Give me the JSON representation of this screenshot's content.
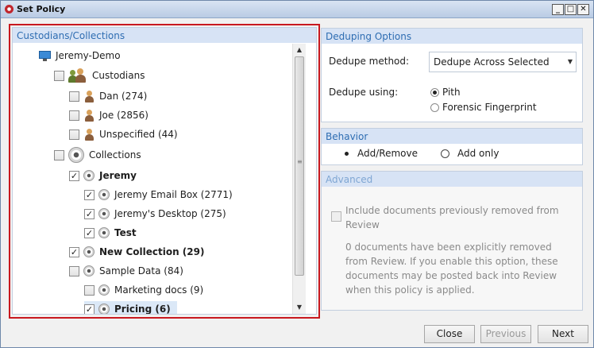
{
  "window": {
    "title": "Set Policy",
    "min": "_",
    "max": "□",
    "close": "✕"
  },
  "left": {
    "header": "Custodians/Collections",
    "tree": [
      {
        "label": "Jeremy-Demo",
        "icon": "monitor",
        "checkbox": false,
        "checked": false,
        "bold": false
      },
      {
        "label": "Custodians",
        "icon": "people",
        "checkbox": true,
        "checked": false,
        "bold": false
      },
      {
        "label": "Dan (274)",
        "icon": "person",
        "checkbox": true,
        "checked": false,
        "bold": false
      },
      {
        "label": "Joe (2856)",
        "icon": "person",
        "checkbox": true,
        "checked": false,
        "bold": false
      },
      {
        "label": "Unspecified (44)",
        "icon": "person",
        "checkbox": true,
        "checked": false,
        "bold": false
      },
      {
        "label": "Collections",
        "icon": "disc-big",
        "checkbox": true,
        "checked": false,
        "bold": false
      },
      {
        "label": "Jeremy",
        "icon": "disc",
        "checkbox": true,
        "checked": true,
        "bold": true
      },
      {
        "label": "Jeremy Email Box (2771)",
        "icon": "disc",
        "checkbox": true,
        "checked": true,
        "bold": false
      },
      {
        "label": "Jeremy's Desktop (275)",
        "icon": "disc",
        "checkbox": true,
        "checked": true,
        "bold": false
      },
      {
        "label": "Test",
        "icon": "disc",
        "checkbox": true,
        "checked": true,
        "bold": true
      },
      {
        "label": "New Collection (29)",
        "icon": "disc",
        "checkbox": true,
        "checked": true,
        "bold": true
      },
      {
        "label": "Sample Data (84)",
        "icon": "disc",
        "checkbox": true,
        "checked": false,
        "bold": false
      },
      {
        "label": "Marketing docs (9)",
        "icon": "disc",
        "checkbox": true,
        "checked": false,
        "bold": false
      },
      {
        "label": "Pricing (6)",
        "icon": "disc",
        "checkbox": true,
        "checked": true,
        "bold": true,
        "selected": true
      }
    ],
    "check_glyph": "✓",
    "scroll_up": "▲",
    "scroll_down": "▼",
    "scroll_grip": "≡"
  },
  "dedup": {
    "header": "Deduping Options",
    "method_label": "Dedupe method:",
    "method_value": "Dedupe Across Selected",
    "using_label": "Dedupe using:",
    "option_pith": "Pith",
    "option_fingerprint": "Forensic Fingerprint",
    "selected_option": "Pith",
    "dropdown_arrow": "▼"
  },
  "behavior": {
    "header": "Behavior",
    "option_add_remove": "Add/Remove",
    "option_add_only": "Add only",
    "selected_option": "Add/Remove"
  },
  "advanced": {
    "header": "Advanced",
    "include_line1": "Include documents previously removed from",
    "include_line2": "Review",
    "note_lines": [
      "0 documents have been explicitly removed",
      "from Review. If you enable this option, these",
      "documents may be posted back into Review",
      "when this policy is applied."
    ]
  },
  "buttons": {
    "close": "Close",
    "previous": "Previous",
    "next": "Next"
  }
}
